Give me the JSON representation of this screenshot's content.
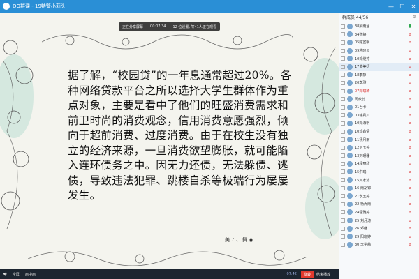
{
  "window": {
    "title": "QQ群课 - 19特警小莉头"
  },
  "share_bar": {
    "status": "正在分享屏幕",
    "timer": "00:07:34",
    "people": "12 位设置, 等41人正在观看"
  },
  "slide": {
    "text": "据了解，“校园贷”的一年息通常超过20%。各种网络贷款平台之所以选择大学生群体作为重点对象，主要是看中了他们的旺盛消费需求和前卫时尚的消费观念，信用消费意愿强烈，倾向于超前消费、过度消费。由于在校生没有独立的经济来源，一旦消费欲望膨胀，就可能陷入连环债务之中。因无力还债，无法躲债、逃债，导致违法犯罪、跳楼自杀等极端行为屡屡发生。",
    "signature": "美 ♪ 、 舞 ◉"
  },
  "controls": {
    "fullscreen": "全屏",
    "floating": "画中画",
    "time": "07:42",
    "red_button": "旋转",
    "right_label": "结束播放"
  },
  "sidebar": {
    "header": "群成员 44/56",
    "members": [
      {
        "name": "38梁雨涵",
        "mic": "on"
      },
      {
        "name": "34张静",
        "mic": "off"
      },
      {
        "name": "05陈宣明",
        "mic": "off"
      },
      {
        "name": "09蒋晓云",
        "mic": "off"
      },
      {
        "name": "10邓继婷",
        "mic": "off"
      },
      {
        "name": "17黄美妍",
        "mic": "off",
        "hl": true
      },
      {
        "name": "18李静",
        "mic": "off"
      },
      {
        "name": "20李雅",
        "mic": "off"
      },
      {
        "name": "07邓琪琦",
        "mic": "off",
        "red": true
      },
      {
        "name": "周欣蕊",
        "mic": "off"
      },
      {
        "name": "01巴卡",
        "mic": "off"
      },
      {
        "name": "03徐兵川",
        "mic": "off"
      },
      {
        "name": "10邓湘明",
        "mic": "off"
      },
      {
        "name": "10邓鑫倩",
        "mic": "off"
      },
      {
        "name": "11杨月雨",
        "mic": "off"
      },
      {
        "name": "12刘玉婷",
        "mic": "off"
      },
      {
        "name": "13刘珊珊",
        "mic": "off"
      },
      {
        "name": "14段丽欣",
        "mic": "off"
      },
      {
        "name": "15洪瑞",
        "mic": "off"
      },
      {
        "name": "15刘家漆",
        "mic": "off"
      },
      {
        "name": "16 雨胡锦",
        "mic": "off"
      },
      {
        "name": "21李玉婷",
        "mic": "off"
      },
      {
        "name": "22 杨沂雨",
        "mic": "off"
      },
      {
        "name": "24程雅婷",
        "mic": "off"
      },
      {
        "name": "25 刘月涛",
        "mic": "off"
      },
      {
        "name": "26 邓继",
        "mic": "off"
      },
      {
        "name": "29 阳晓婷",
        "mic": "off"
      },
      {
        "name": "30 李学茜",
        "mic": "off"
      }
    ]
  }
}
